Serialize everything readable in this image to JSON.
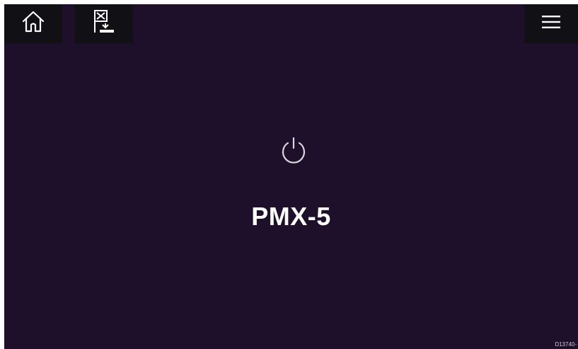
{
  "colors": {
    "background": "#1e0f2b",
    "button_background": "#111014",
    "icon": "#ffffff",
    "power_icon": "#d9d7dc"
  },
  "toolbar": {
    "home_icon": "home-icon",
    "mob_icon": "man-overboard-icon",
    "menu_icon": "hamburger-menu-icon"
  },
  "main": {
    "power_icon": "power-icon",
    "device_name": "PMX-5"
  },
  "footer": {
    "reference_code": "D13740-"
  }
}
